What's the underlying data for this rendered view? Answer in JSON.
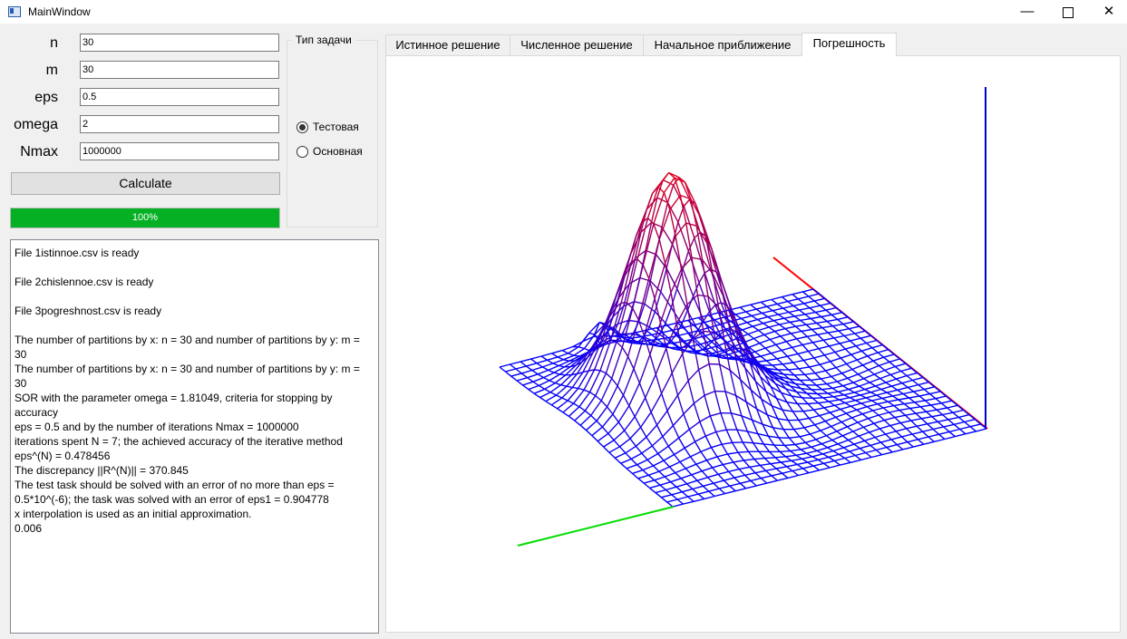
{
  "window": {
    "title": "MainWindow",
    "minimize": "—",
    "close": "✕"
  },
  "params": {
    "n": {
      "label": "n",
      "value": "30"
    },
    "m": {
      "label": "m",
      "value": "30"
    },
    "eps": {
      "label": "eps",
      "value": "0.5"
    },
    "omega": {
      "label": "omega",
      "value": "2"
    },
    "nmax": {
      "label": "Nmax",
      "value": "1000000"
    }
  },
  "calculate_label": "Calculate",
  "progress": {
    "value": 100,
    "text": "100%",
    "color": "#06b025"
  },
  "task_type": {
    "title": "Тип задачи",
    "options": [
      {
        "label": "Тестовая",
        "selected": true
      },
      {
        "label": "Основная",
        "selected": false
      }
    ]
  },
  "log_lines": [
    "File 1istinnoe.csv is ready",
    "",
    "File 2chislennoe.csv is ready",
    "",
    "File 3pogreshnost.csv is ready",
    "",
    "The number of partitions by x: n = 30 and number of partitions by y: m =",
    "30",
    "The number of partitions by x: n = 30 and number of partitions by y: m =",
    "30",
    "SOR with the parameter omega = 1.81049, criteria for stopping by accuracy",
    "eps = 0.5 and by the number of iterations Nmax = 1000000",
    "iterations spent N = 7; the achieved accuracy of the iterative method",
    "eps^(N) = 0.478456",
    "The discrepancy ||R^(N)|| = 370.845",
    "The test task should be solved with an error of no more than eps =",
    "0.5*10^(-6); the task was solved with an error of eps1 = 0.904778",
    "x interpolation is used as an initial approximation.",
    "0.006"
  ],
  "tabs": [
    {
      "label": "Истинное решение",
      "active": false
    },
    {
      "label": "Численное решение",
      "active": false
    },
    {
      "label": "Начальное приближение",
      "active": false
    },
    {
      "label": "Погрешность",
      "active": true
    }
  ],
  "plot": {
    "grid_size": 30,
    "low_color": "#0000ff",
    "high_color": "#ff0000",
    "axis_colors": {
      "x": "#00dd00",
      "y": "#ff0000",
      "z": "#0000cc"
    }
  }
}
